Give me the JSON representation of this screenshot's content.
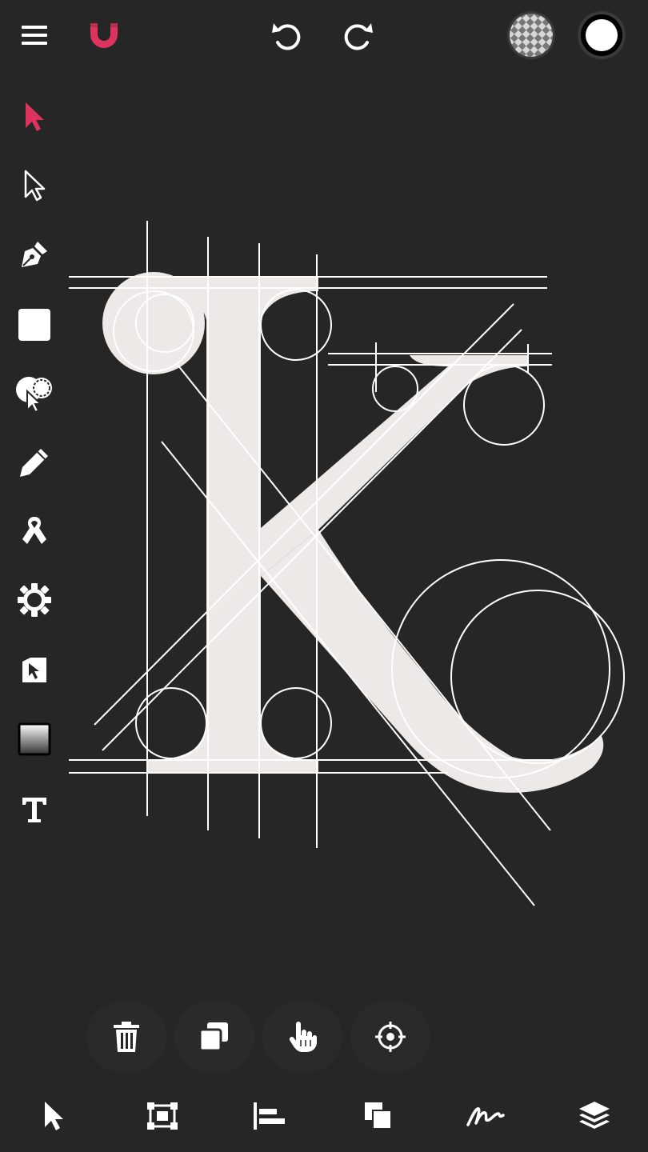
{
  "colors": {
    "background": "#262626",
    "accent": "#e0325e",
    "icon": "#ffffff",
    "glyph_fill": "#ece9e6",
    "guide_stroke": "#ffffff"
  },
  "top_bar": {
    "icons": [
      "menu-icon",
      "magnet-icon",
      "undo-icon",
      "redo-icon",
      "transparent-fill-swatch",
      "white-stroke-swatch"
    ]
  },
  "left_toolbar": {
    "active_tool": "selection-tool",
    "tools": [
      "selection-arrow-icon",
      "direct-selection-arrow-icon",
      "pen-nib-icon",
      "rectangle-icon",
      "shape-builder-icon",
      "pencil-icon",
      "ribbon-icon",
      "gear-shape-icon",
      "node-edit-icon",
      "gradient-swatch-icon",
      "text-tool-icon"
    ]
  },
  "canvas": {
    "glyph": "K",
    "description_visible": false
  },
  "action_bar": {
    "icons": [
      "trash-icon",
      "duplicate-icon",
      "hand-pointer-icon",
      "crosshair-icon"
    ]
  },
  "bottom_bar": {
    "icons": [
      "select-arrow-icon",
      "transform-box-icon",
      "align-left-icon",
      "arrange-icon",
      "signature-icon",
      "layers-icon"
    ]
  }
}
